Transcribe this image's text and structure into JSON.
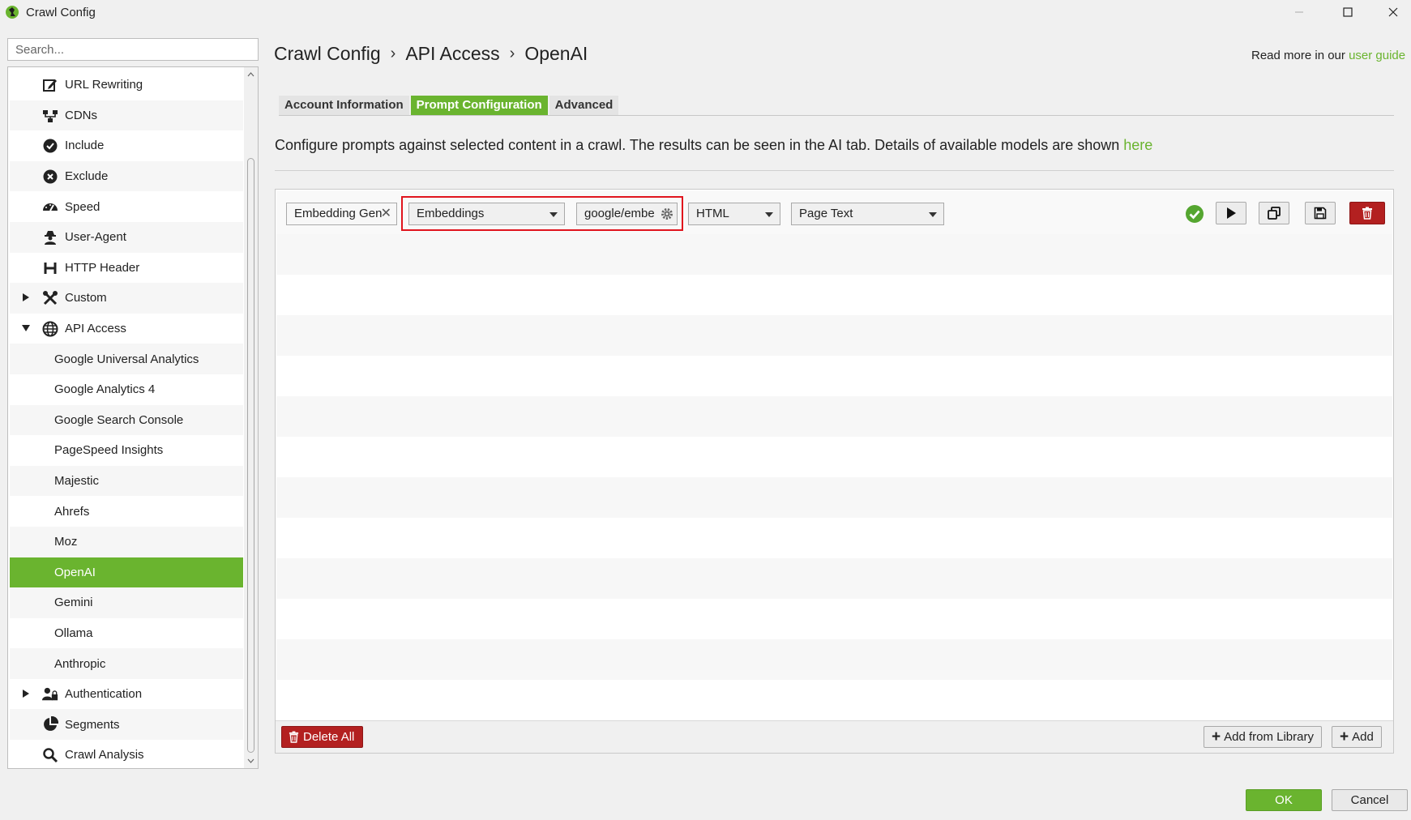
{
  "window": {
    "title": "Crawl Config"
  },
  "search": {
    "placeholder": "Search..."
  },
  "sidebar": {
    "items": [
      {
        "label": "URL Rewriting",
        "icon": "edit-icon"
      },
      {
        "label": "CDNs",
        "icon": "sitemap-icon"
      },
      {
        "label": "Include",
        "icon": "check-circle-icon"
      },
      {
        "label": "Exclude",
        "icon": "x-circle-icon"
      },
      {
        "label": "Speed",
        "icon": "speedometer-icon"
      },
      {
        "label": "User-Agent",
        "icon": "user-secret-icon"
      },
      {
        "label": "HTTP Header",
        "icon": "heading-icon"
      },
      {
        "label": "Custom",
        "icon": "tools-icon",
        "caret": "collapsed"
      },
      {
        "label": "API Access",
        "icon": "globe-icon",
        "caret": "expanded"
      },
      {
        "label": "Google Universal Analytics"
      },
      {
        "label": "Google Analytics 4"
      },
      {
        "label": "Google Search Console"
      },
      {
        "label": "PageSpeed Insights"
      },
      {
        "label": "Majestic"
      },
      {
        "label": "Ahrefs"
      },
      {
        "label": "Moz"
      },
      {
        "label": "OpenAI",
        "selected": true
      },
      {
        "label": "Gemini"
      },
      {
        "label": "Ollama"
      },
      {
        "label": "Anthropic"
      },
      {
        "label": "Authentication",
        "icon": "user-lock-icon",
        "caret": "collapsed"
      },
      {
        "label": "Segments",
        "icon": "pie-chart-icon"
      },
      {
        "label": "Crawl Analysis",
        "icon": "search-icon"
      }
    ]
  },
  "breadcrumb": [
    "Crawl Config",
    "API Access",
    "OpenAI"
  ],
  "help": {
    "prefix": "Read more in our ",
    "link": "user guide"
  },
  "tabs": [
    "Account Information",
    "Prompt Configuration",
    "Advanced"
  ],
  "active_tab": "Prompt Configuration",
  "description": {
    "text": "Configure prompts against selected content in a crawl. The results can be seen in the AI tab. Details of available models are shown ",
    "link": "here"
  },
  "prompt": {
    "name": "Embedding Gen",
    "type": "Embeddings",
    "model": "google/embe",
    "format": "HTML",
    "source": "Page Text",
    "status": "valid"
  },
  "footer": {
    "delete_all": "Delete All",
    "add_from_library": "Add from Library",
    "add": "Add"
  },
  "dialog": {
    "ok": "OK",
    "cancel": "Cancel"
  },
  "colors": {
    "accent": "#6ab42f",
    "danger": "#b32020",
    "highlight": "#e0141d"
  }
}
